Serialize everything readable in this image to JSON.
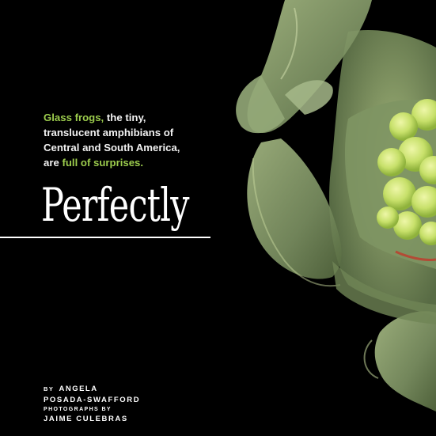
{
  "deck": {
    "line1_accent": "Glass frogs,",
    "line1_rest": " the tiny,",
    "line2": "translucent amphibians of",
    "line3": "Central and South America,",
    "line4_start": "are ",
    "line4_accent": "full of surprises."
  },
  "headline": "Perfectly",
  "byline": {
    "prefix": "BY",
    "author_line1": "ANGELA",
    "author_line2": "POSADA-SWAFFORD"
  },
  "credits": {
    "label": "PHOTOGRAPHS BY",
    "photographer": "JAIME CULEBRAS"
  },
  "colors": {
    "background": "#000000",
    "accent": "#9ccc4d",
    "text": "#ffffff"
  },
  "photo": {
    "subject": "glass-frog-photo"
  }
}
